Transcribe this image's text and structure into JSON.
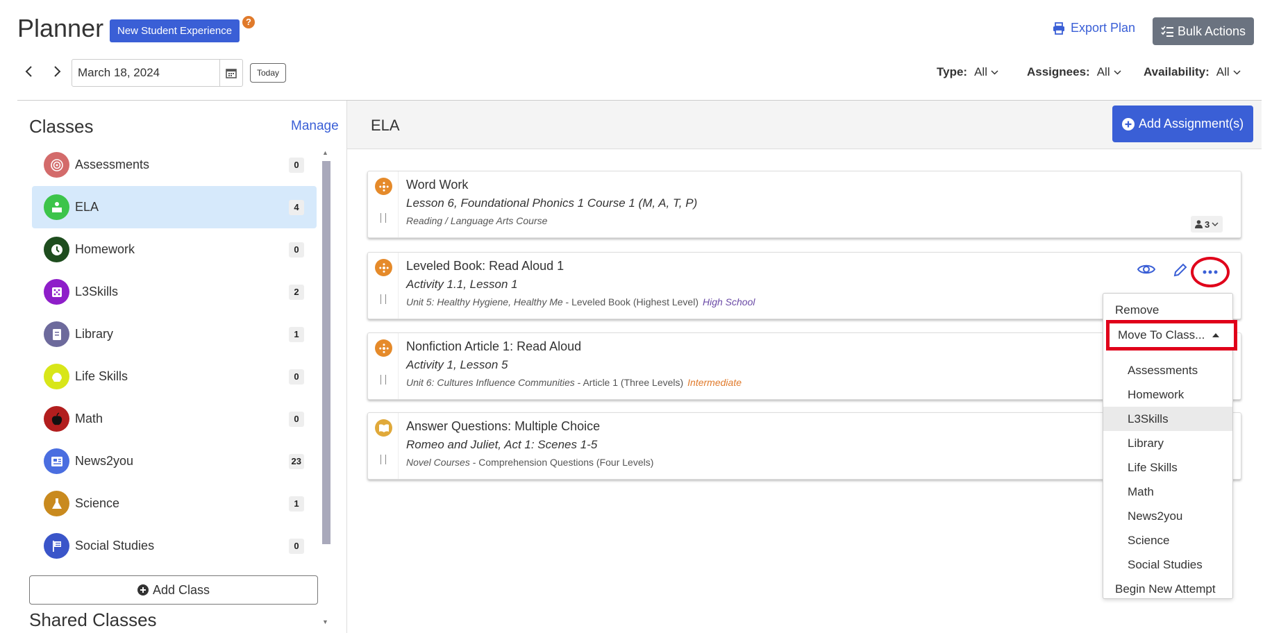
{
  "header": {
    "title": "Planner",
    "nse_label": "New Student Experience",
    "help_glyph": "?",
    "export_label": "Export Plan",
    "bulk_label": "Bulk Actions"
  },
  "date_nav": {
    "prev_glyph": "‹",
    "next_glyph": "›",
    "date_value": "March 18, 2024",
    "today_label": "Today"
  },
  "filters": [
    {
      "label": "Type:",
      "value": "All"
    },
    {
      "label": "Assignees:",
      "value": "All"
    },
    {
      "label": "Availability:",
      "value": "All"
    }
  ],
  "sidebar": {
    "title": "Classes",
    "manage_label": "Manage",
    "classes": [
      {
        "name": "Assessments",
        "count": "0",
        "icon": "target-icon",
        "color": "#d36b6b"
      },
      {
        "name": "ELA",
        "count": "4",
        "icon": "reading-icon",
        "color": "#3cc44a",
        "active": true
      },
      {
        "name": "Homework",
        "count": "0",
        "icon": "clock-icon",
        "color": "#1e4d1e"
      },
      {
        "name": "L3Skills",
        "count": "2",
        "icon": "dice-icon",
        "color": "#8e1ec9"
      },
      {
        "name": "Library",
        "count": "1",
        "icon": "book-icon",
        "color": "#6d6a9c"
      },
      {
        "name": "Life Skills",
        "count": "0",
        "icon": "hands-icon",
        "color": "#d8e619"
      },
      {
        "name": "Math",
        "count": "0",
        "icon": "apple-icon",
        "color": "#b21e1e"
      },
      {
        "name": "News2you",
        "count": "23",
        "icon": "newspaper-icon",
        "color": "#4a6ee0"
      },
      {
        "name": "Science",
        "count": "1",
        "icon": "flask-icon",
        "color": "#c98a1e"
      },
      {
        "name": "Social Studies",
        "count": "0",
        "icon": "flag-icon",
        "color": "#3a55c9"
      }
    ],
    "add_class_label": "Add Class",
    "shared_title": "Shared Classes"
  },
  "main": {
    "title": "ELA",
    "add_assignment_label": "Add Assignment(s)",
    "cards": [
      {
        "title": "Word Work",
        "subtitle": "Lesson 6, Foundational Phonics 1 Course 1 (M, A, T, P)",
        "meta_italic": "Reading / Language Arts Course",
        "meta_rest": "",
        "level": "",
        "icon_color": "#e58a2a",
        "assignee_count": "3"
      },
      {
        "title": "Leveled Book: Read Aloud 1",
        "subtitle": "Activity 1.1, Lesson 1",
        "meta_italic": "Unit 5: Healthy Hygiene, Healthy Me",
        "meta_rest": " - Leveled Book (Highest Level)",
        "level": "High School",
        "icon_color": "#e58a2a"
      },
      {
        "title": "Nonfiction Article 1: Read Aloud",
        "subtitle": "Activity 1, Lesson 5",
        "meta_italic": "Unit 6: Cultures Influence Communities",
        "meta_rest": " - Article 1 (Three Levels)",
        "level": "Intermediate",
        "icon_color": "#e58a2a"
      },
      {
        "title": "Answer Questions: Multiple Choice",
        "subtitle": "Romeo and Juliet, Act 1: Scenes 1-5",
        "meta_italic": "Novel Courses",
        "meta_rest": " - Comprehension Questions (Four Levels)",
        "level": "",
        "icon_color": "#e0a93a"
      }
    ]
  },
  "dropdown": {
    "remove_label": "Remove",
    "move_label": "Move To Class...",
    "classes": [
      "Assessments",
      "Homework",
      "L3Skills",
      "Library",
      "Life Skills",
      "Math",
      "News2you",
      "Science",
      "Social Studies"
    ],
    "hovered": "L3Skills",
    "attempt_label": "Begin New Attempt"
  },
  "colors": {
    "primary": "#3a5fd6",
    "highlight_red": "#e0001a",
    "active_row": "#d6e9fb"
  }
}
